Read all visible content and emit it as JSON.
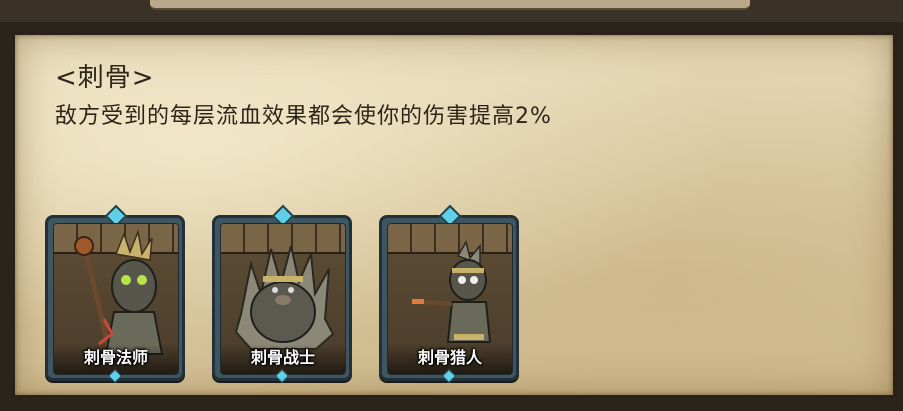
{
  "ability": {
    "title": "<刺骨>",
    "description": "敌方受到的每层流血效果都会使你的伤害提高2%"
  },
  "units": [
    {
      "name": "刺骨法师",
      "icon": "spiky-mage-portrait"
    },
    {
      "name": "刺骨战士",
      "icon": "spiky-warrior-portrait"
    },
    {
      "name": "刺骨猎人",
      "icon": "spiky-hunter-portrait"
    }
  ],
  "colors": {
    "parchment": "#dccba4",
    "card_border": "#3e5662",
    "gem": "#5fd0e6",
    "text": "#2e2519"
  }
}
